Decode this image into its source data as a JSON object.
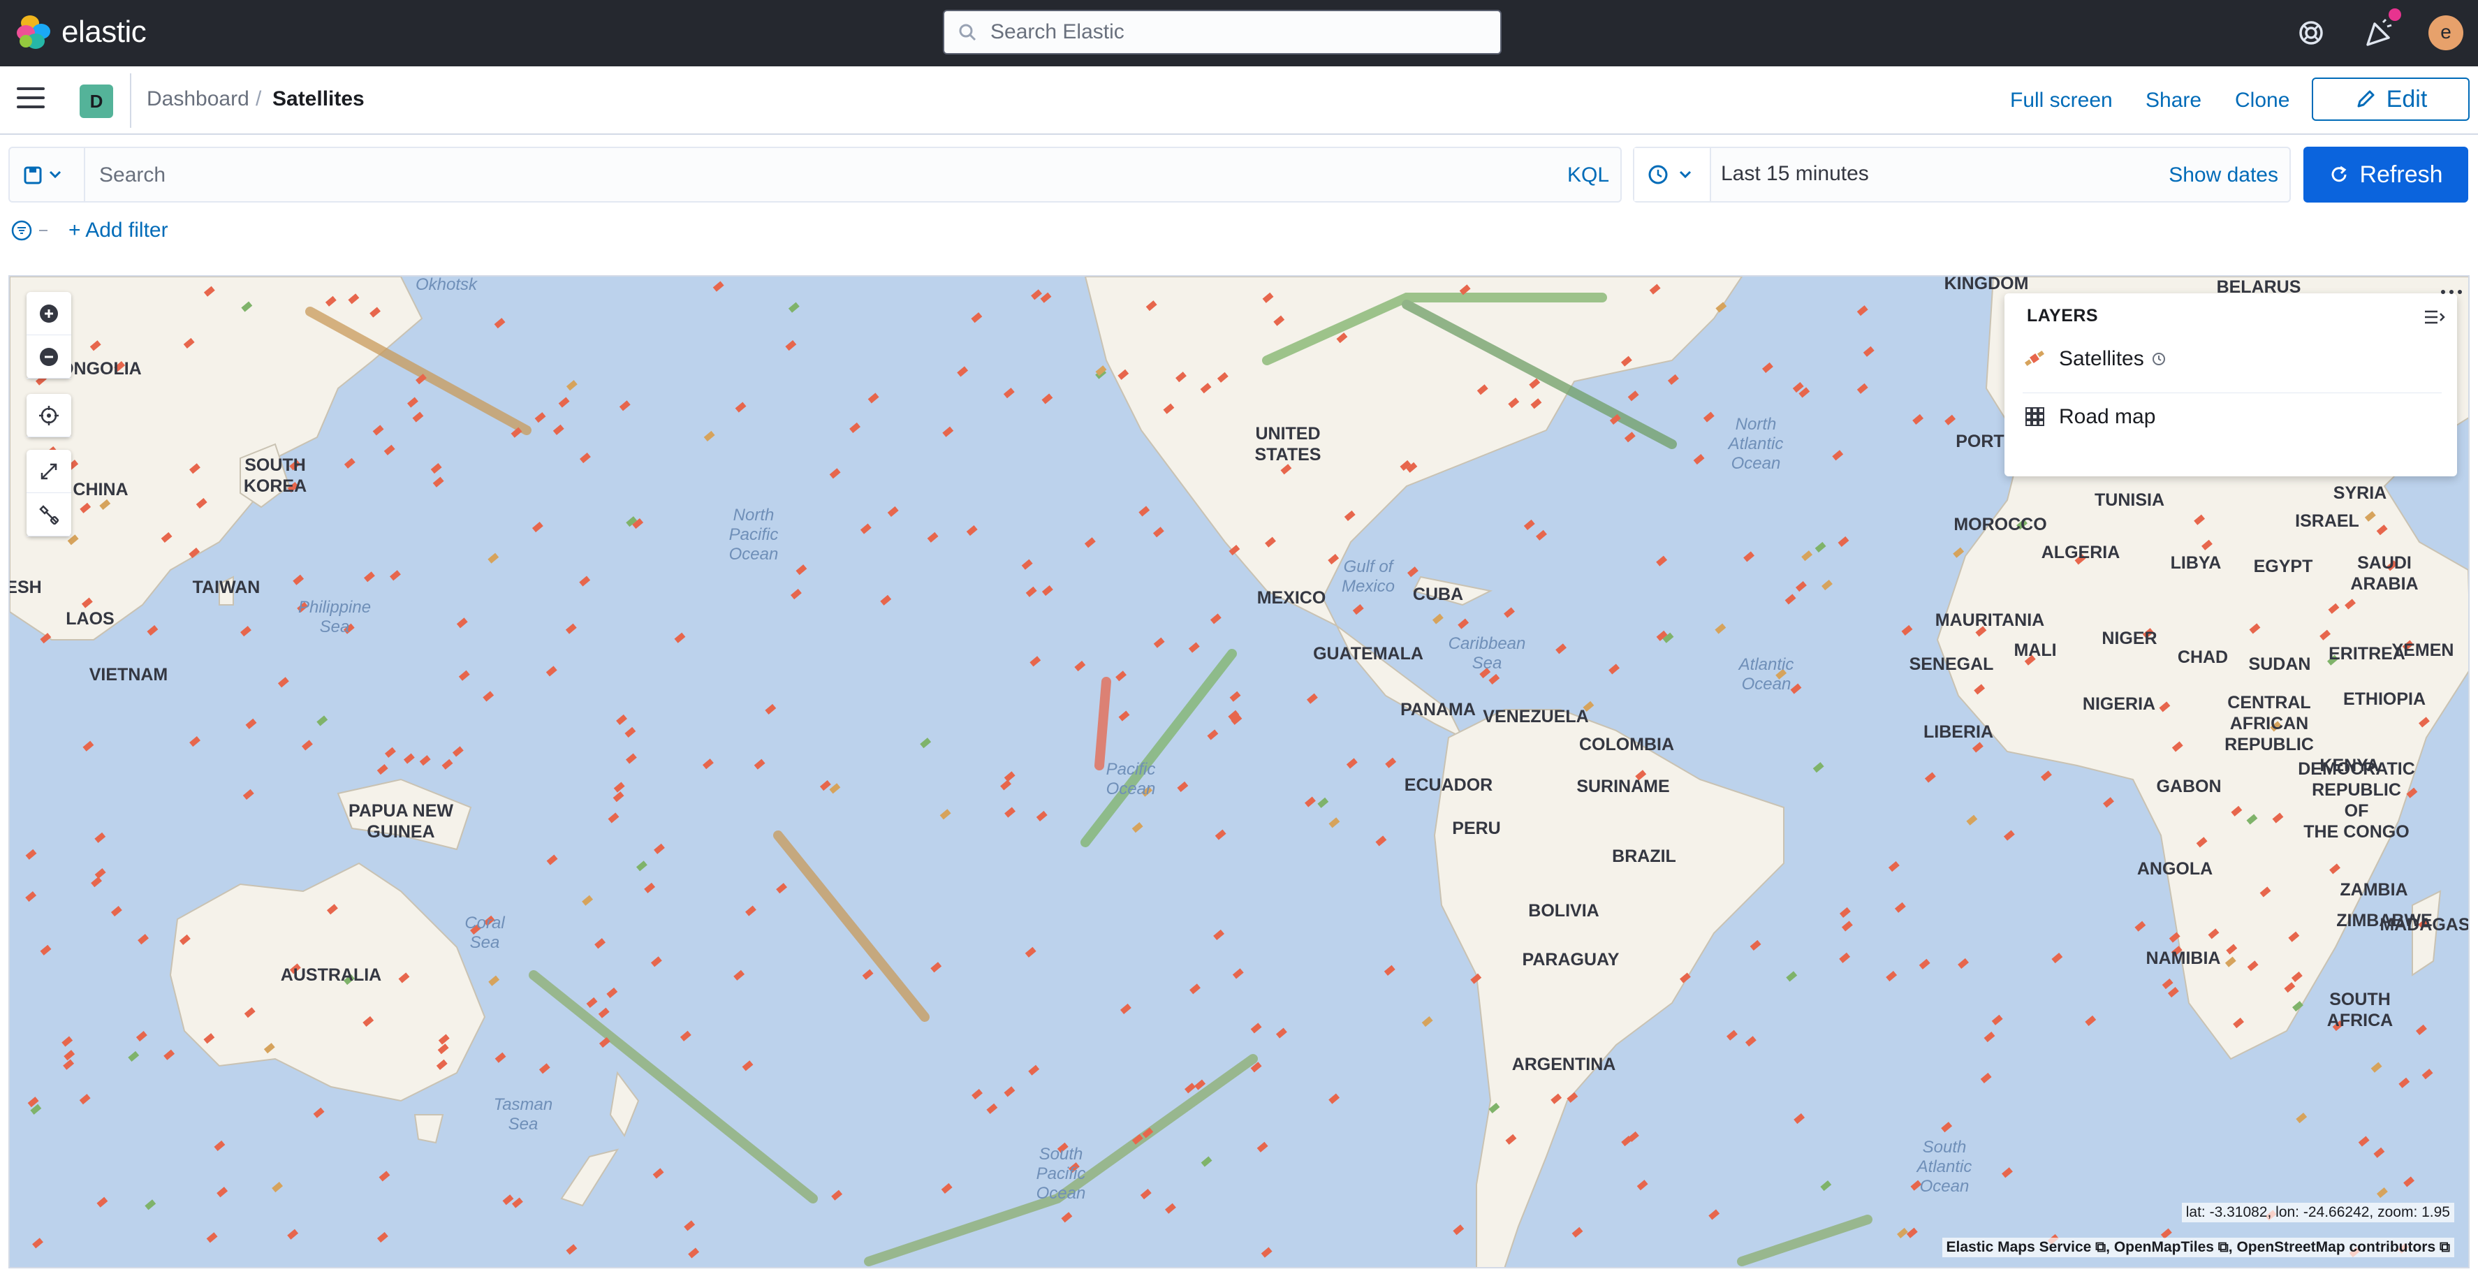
{
  "app": {
    "name": "elastic"
  },
  "header": {
    "search_placeholder": "Search Elastic",
    "avatar_initial": "e"
  },
  "breadcrumbs": {
    "space_initial": "D",
    "parent": "Dashboard",
    "separator": "/",
    "current": "Satellites"
  },
  "actions": {
    "fullscreen": "Full screen",
    "share": "Share",
    "clone": "Clone",
    "edit": "Edit"
  },
  "query": {
    "placeholder": "Search",
    "language": "KQL"
  },
  "time": {
    "range": "Last 15 minutes",
    "show_dates": "Show dates",
    "refresh": "Refresh"
  },
  "filters": {
    "add": "+ Add filter"
  },
  "layers": {
    "title": "LAYERS",
    "items": [
      {
        "label": "Satellites",
        "icon": "satellite-layer-icon"
      },
      {
        "label": "Road map",
        "icon": "grid-layer-icon"
      }
    ]
  },
  "map": {
    "coords": "lat: -3.31082, lon: -24.66242, zoom: 1.95",
    "attribution": "Elastic Maps Service ⧉, OpenMapTiles ⧉, OpenStreetMap contributors ⧉",
    "labels": [
      {
        "t": "MONGOLIA"
      },
      {
        "t": "CHINA"
      },
      {
        "t": "SOUTH\nKOREA"
      },
      {
        "t": "TAIWAN"
      },
      {
        "t": "LAOS"
      },
      {
        "t": "VIETNAM"
      },
      {
        "t": "PAPUA NEW\nGUINEA"
      },
      {
        "t": "AUSTRALIA"
      },
      {
        "t": "UNITED\nSTATES"
      },
      {
        "t": "MEXICO"
      },
      {
        "t": "CUBA"
      },
      {
        "t": "GUATEMALA"
      },
      {
        "t": "PANAMA"
      },
      {
        "t": "VENEZUELA"
      },
      {
        "t": "COLOMBIA"
      },
      {
        "t": "SURINAME"
      },
      {
        "t": "ECUADOR"
      },
      {
        "t": "PERU"
      },
      {
        "t": "BRAZIL"
      },
      {
        "t": "BOLIVIA"
      },
      {
        "t": "PARAGUAY"
      },
      {
        "t": "ARGENTINA"
      },
      {
        "t": "KINGDOM"
      },
      {
        "t": "BELARUS"
      },
      {
        "t": "PORTU"
      },
      {
        "t": "TUNISIA"
      },
      {
        "t": "SYRIA"
      },
      {
        "t": "MOROCCO"
      },
      {
        "t": "ISRAEL"
      },
      {
        "t": "ALGERIA"
      },
      {
        "t": "LIBYA"
      },
      {
        "t": "EGYPT"
      },
      {
        "t": "SAUDI\nARABIA"
      },
      {
        "t": "MAURITANIA"
      },
      {
        "t": "MALI"
      },
      {
        "t": "NIGER"
      },
      {
        "t": "CHAD"
      },
      {
        "t": "SUDAN"
      },
      {
        "t": "ERITREA"
      },
      {
        "t": "YEMEN"
      },
      {
        "t": "SENEGAL"
      },
      {
        "t": "NIGERIA"
      },
      {
        "t": "CENTRAL\nAFRICAN\nREPUBLIC"
      },
      {
        "t": "ETHIOPIA"
      },
      {
        "t": "LIBERIA"
      },
      {
        "t": "KENYA"
      },
      {
        "t": "GABON"
      },
      {
        "t": "DEMOCRATIC\nREPUBLIC OF\nTHE CONGO"
      },
      {
        "t": "ANGOLA"
      },
      {
        "t": "ZAMBIA"
      },
      {
        "t": "ZIMBABWE"
      },
      {
        "t": "MADAGASCAR"
      },
      {
        "t": "NAMIBIA"
      },
      {
        "t": "SOUTH\nAFRICA"
      },
      {
        "t": "ESH"
      }
    ],
    "oceans": [
      {
        "t": "Okhotsk"
      },
      {
        "t": "Philippine\nSea"
      },
      {
        "t": "North\nPacific\nOcean"
      },
      {
        "t": "Gulf of\nMexico"
      },
      {
        "t": "Caribbean\nSea"
      },
      {
        "t": "North\nAtlantic\nOcean"
      },
      {
        "t": "Atlantic\nOcean"
      },
      {
        "t": "Pacific\nOcean"
      },
      {
        "t": "Coral\nSea"
      },
      {
        "t": "Tasman\nSea"
      },
      {
        "t": "South\nPacific\nOcean"
      },
      {
        "t": "South\nAtlantic\nOcean"
      }
    ]
  },
  "colors": {
    "header_bg": "#25282f",
    "primary": "#0b64dd",
    "link": "#006bb8",
    "water": "#bcd2ec",
    "land": "#f5f2ea",
    "sat_red": "#e7664c",
    "sat_green": "#7fb36a",
    "sat_orange": "#d6a35c"
  }
}
